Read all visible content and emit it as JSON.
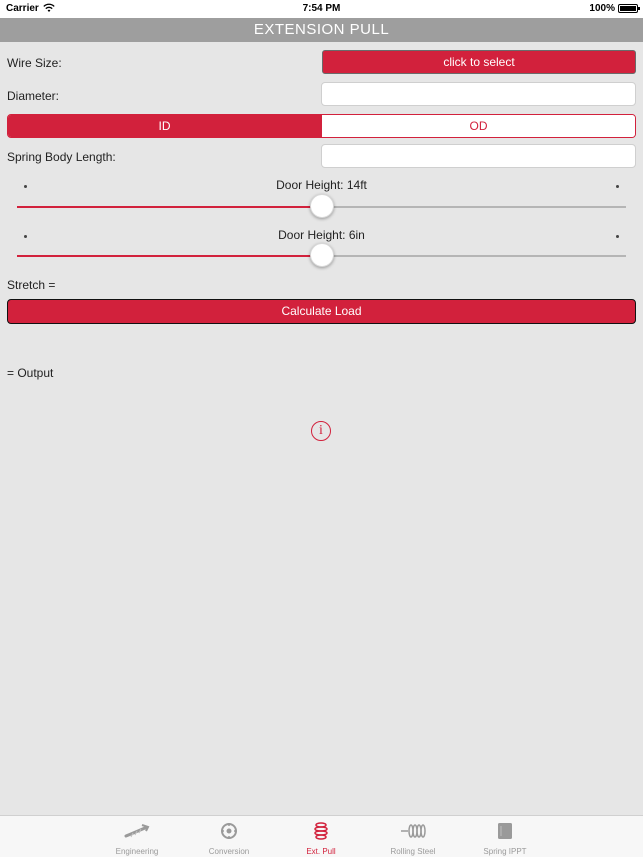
{
  "status_bar": {
    "carrier": "Carrier",
    "time": "7:54 PM",
    "battery": "100%"
  },
  "nav": {
    "title": "EXTENSION PULL"
  },
  "form": {
    "wire_size_label": "Wire Size:",
    "wire_size_button": "click to select",
    "diameter_label": "Diameter:",
    "diameter_value": "",
    "segment_id": "ID",
    "segment_od": "OD",
    "body_length_label": "Spring Body Length:",
    "body_length_value": ""
  },
  "sliders": [
    {
      "label": "Door Height: 14ft",
      "level": 0.5
    },
    {
      "label": "Door Height: 6in",
      "level": 0.5
    }
  ],
  "stretch_label": "Stretch =",
  "calculate_label": "Calculate Load",
  "output_label": "= Output",
  "info_glyph": "i",
  "tabs": [
    {
      "label": "Engineering",
      "icon": "spring-tool-icon",
      "active": false
    },
    {
      "label": "Conversion",
      "icon": "conversion-icon",
      "active": false
    },
    {
      "label": "Ext. Pull",
      "icon": "extension-spring-icon",
      "active": true
    },
    {
      "label": "Rolling Steel",
      "icon": "rolling-steel-icon",
      "active": false
    },
    {
      "label": "Spring IPPT",
      "icon": "spring-ippt-icon",
      "active": false
    }
  ],
  "colors": {
    "accent": "#d2213c",
    "nav_bg": "#9e9e9e",
    "page_bg": "#e6e6e6"
  }
}
